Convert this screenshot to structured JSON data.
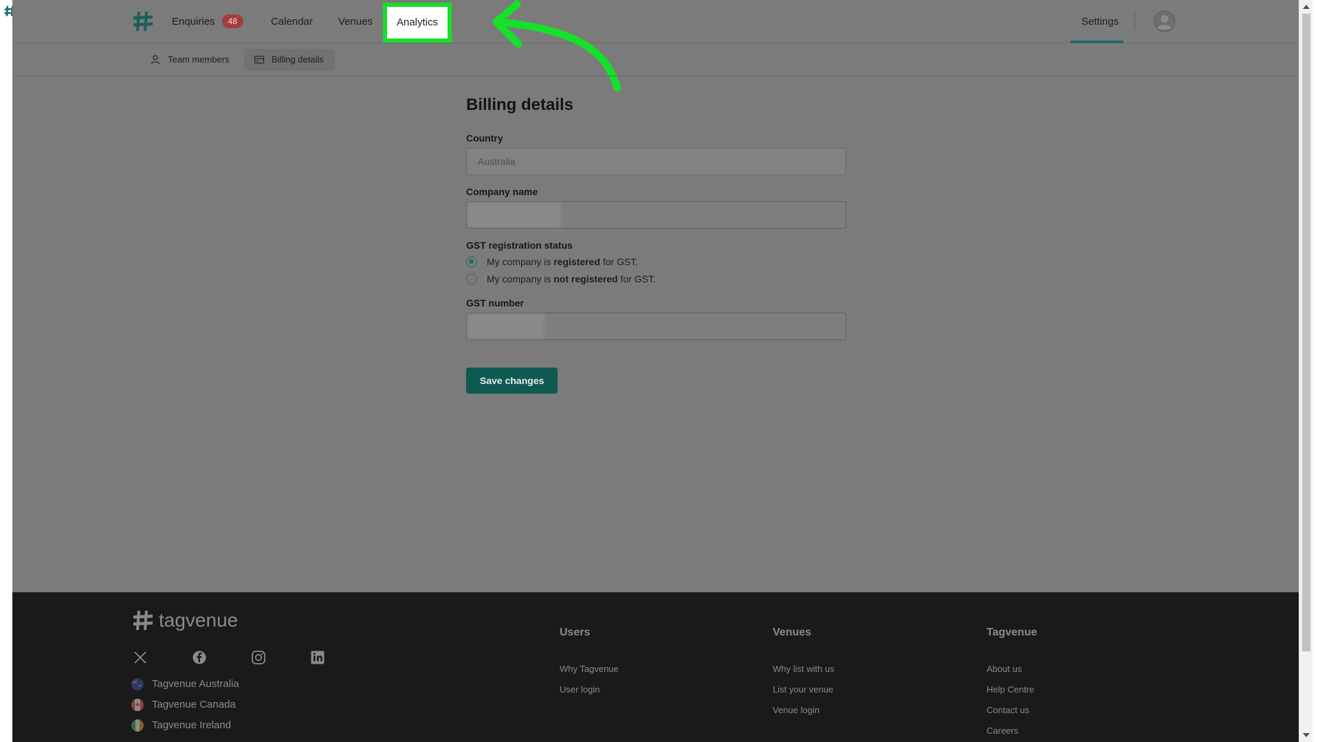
{
  "nav": {
    "enquiries": "Enquiries",
    "enquiries_badge": "48",
    "calendar": "Calendar",
    "venues": "Venues",
    "analytics": "Analytics",
    "settings": "Settings"
  },
  "subnav": {
    "team_members": "Team members",
    "billing_details": "Billing details"
  },
  "billing": {
    "title": "Billing details",
    "country_label": "Country",
    "country_value": "Australia",
    "company_label": "Company name",
    "company_value": "",
    "gst_status_label": "GST registration status",
    "radio_registered_pre": "My company is ",
    "radio_registered_bold": "registered",
    "radio_registered_post": " for GST.",
    "radio_not_pre": "My company is ",
    "radio_not_bold": "not registered",
    "radio_not_post": " for GST.",
    "gst_number_label": "GST number",
    "gst_number_value": "",
    "save_button": "Save changes"
  },
  "footer": {
    "brand": "tagvenue",
    "countries": [
      "Tagvenue Australia",
      "Tagvenue Canada",
      "Tagvenue Ireland"
    ],
    "columns": [
      {
        "title": "Users",
        "links": [
          "Why Tagvenue",
          "User login"
        ]
      },
      {
        "title": "Venues",
        "links": [
          "Why list with us",
          "List your venue",
          "Venue login"
        ]
      },
      {
        "title": "Tagvenue",
        "links": [
          "About us",
          "Help Centre",
          "Contact us",
          "Careers"
        ]
      }
    ],
    "social_icons": [
      "x-icon",
      "facebook-icon",
      "instagram-icon",
      "linkedin-icon"
    ]
  },
  "colors": {
    "accent": "#1e6e68",
    "highlight": "#15e02a",
    "badge": "#a43d3d",
    "save_button": "#0e5a52"
  }
}
